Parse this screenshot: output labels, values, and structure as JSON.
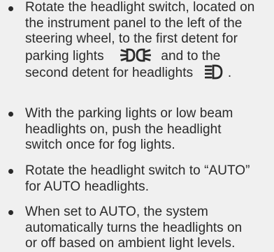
{
  "bullets": [
    {
      "lines": [
        "Rotate the headlight switch, located on",
        "the instrument panel to the left of the",
        "steering wheel, to the first detent for",
        "parking lights",
        "and to the",
        "second detent for headlights",
        "."
      ]
    },
    {
      "lines": [
        "With the parking lights or low beam",
        "headlights on, push the headlight",
        "switch once for fog lights."
      ]
    },
    {
      "lines": [
        "Rotate the headlight switch to “AUTO”",
        "for AUTO headlights."
      ]
    },
    {
      "lines": [
        "When set to AUTO, the system",
        "automatically turns the headlights on",
        "or off based on ambient light levels."
      ]
    }
  ],
  "icons": {
    "parking": "parking-lights-icon",
    "headlight": "headlight-icon"
  }
}
